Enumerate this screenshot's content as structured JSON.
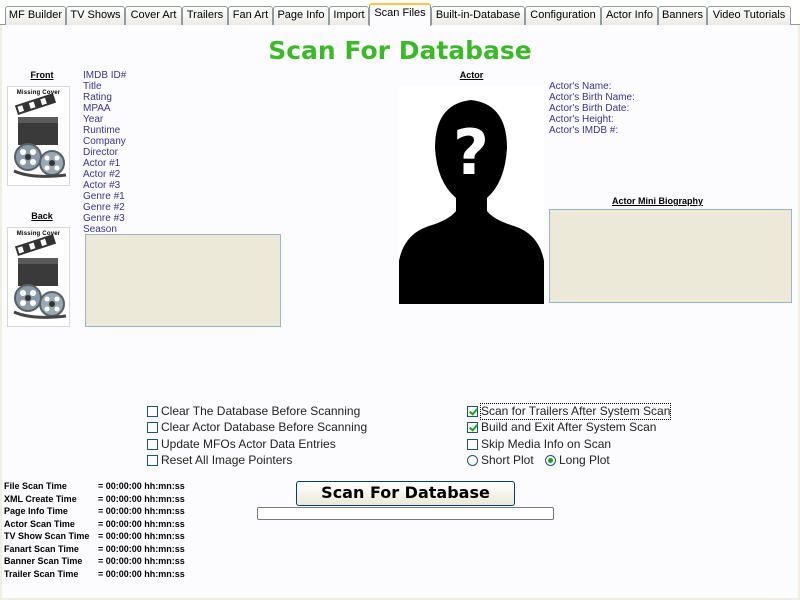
{
  "tabs": [
    {
      "label": "MF Builder",
      "active": false
    },
    {
      "label": "TV Shows",
      "active": false
    },
    {
      "label": "Cover Art",
      "active": false
    },
    {
      "label": "Trailers",
      "active": false
    },
    {
      "label": "Fan Art",
      "active": false
    },
    {
      "label": "Page Info",
      "active": false
    },
    {
      "label": "Import",
      "active": false
    },
    {
      "label": "Scan Files",
      "active": true
    },
    {
      "label": "Built-in-Database",
      "active": false
    },
    {
      "label": "Configuration",
      "active": false
    },
    {
      "label": "Actor Info",
      "active": false
    },
    {
      "label": "Banners",
      "active": false
    },
    {
      "label": "Video Tutorials",
      "active": false
    }
  ],
  "title": "Scan For Database",
  "front_label": "Front",
  "back_label": "Back",
  "missing_cover_text": "Missing Cover",
  "info_fields": [
    "IMDB ID#",
    "Title",
    "Rating",
    "MPAA",
    "Year",
    "Runtime",
    "Company",
    "Director",
    "Actor #1",
    "Actor #2",
    "Actor #3",
    "Genre #1",
    "Genre #2",
    "Genre #3",
    "Season"
  ],
  "actor_label": "Actor",
  "actor_fields": [
    "Actor's Name:",
    "Actor's Birth Name:",
    "Actor's Birth Date:",
    "Actor's Height:",
    "Actor's IMDB #:"
  ],
  "actor_bio_label": "Actor Mini Biography",
  "options_left": [
    {
      "label": "Clear The Database Before Scanning",
      "checked": false
    },
    {
      "label": "Clear Actor Database Before Scanning",
      "checked": false
    },
    {
      "label": "Update MFOs Actor Data Entries",
      "checked": false
    },
    {
      "label": "Reset All Image Pointers",
      "checked": false
    }
  ],
  "options_right": [
    {
      "label": "Scan for Trailers After System Scan",
      "checked": true
    },
    {
      "label": "Build and Exit After System Scan",
      "checked": true
    },
    {
      "label": "Skip Media Info on Scan",
      "checked": false
    }
  ],
  "plot_options": [
    {
      "label": "Short Plot",
      "selected": false
    },
    {
      "label": "Long Plot",
      "selected": true
    }
  ],
  "scan_button": "Scan For Database",
  "scan_progress": 0,
  "times": [
    {
      "label": "File Scan Time",
      "value": "= 00:00:00 hh:mn:ss"
    },
    {
      "label": "XML Create Time",
      "value": "= 00:00:00 hh:mn:ss"
    },
    {
      "label": "Page Info Time",
      "value": "= 00:00:00 hh:mn:ss"
    },
    {
      "label": "Actor Scan Time",
      "value": "= 00:00:00 hh:mn:ss"
    },
    {
      "label": "TV Show Scan Time",
      "value": "= 00:00:00 hh:mn:ss"
    },
    {
      "label": "Fanart Scan Time",
      "value": "= 00:00:00 hh:mn:ss"
    },
    {
      "label": "Banner Scan Time",
      "value": "= 00:00:00 hh:mn:ss"
    },
    {
      "label": "Trailer Scan Time",
      "value": "= 00:00:00 hh:mn:ss"
    }
  ],
  "colors": {
    "title": "#3cb92a",
    "field_text": "#3a3390",
    "active_tab_accent": "#ffc83c"
  }
}
